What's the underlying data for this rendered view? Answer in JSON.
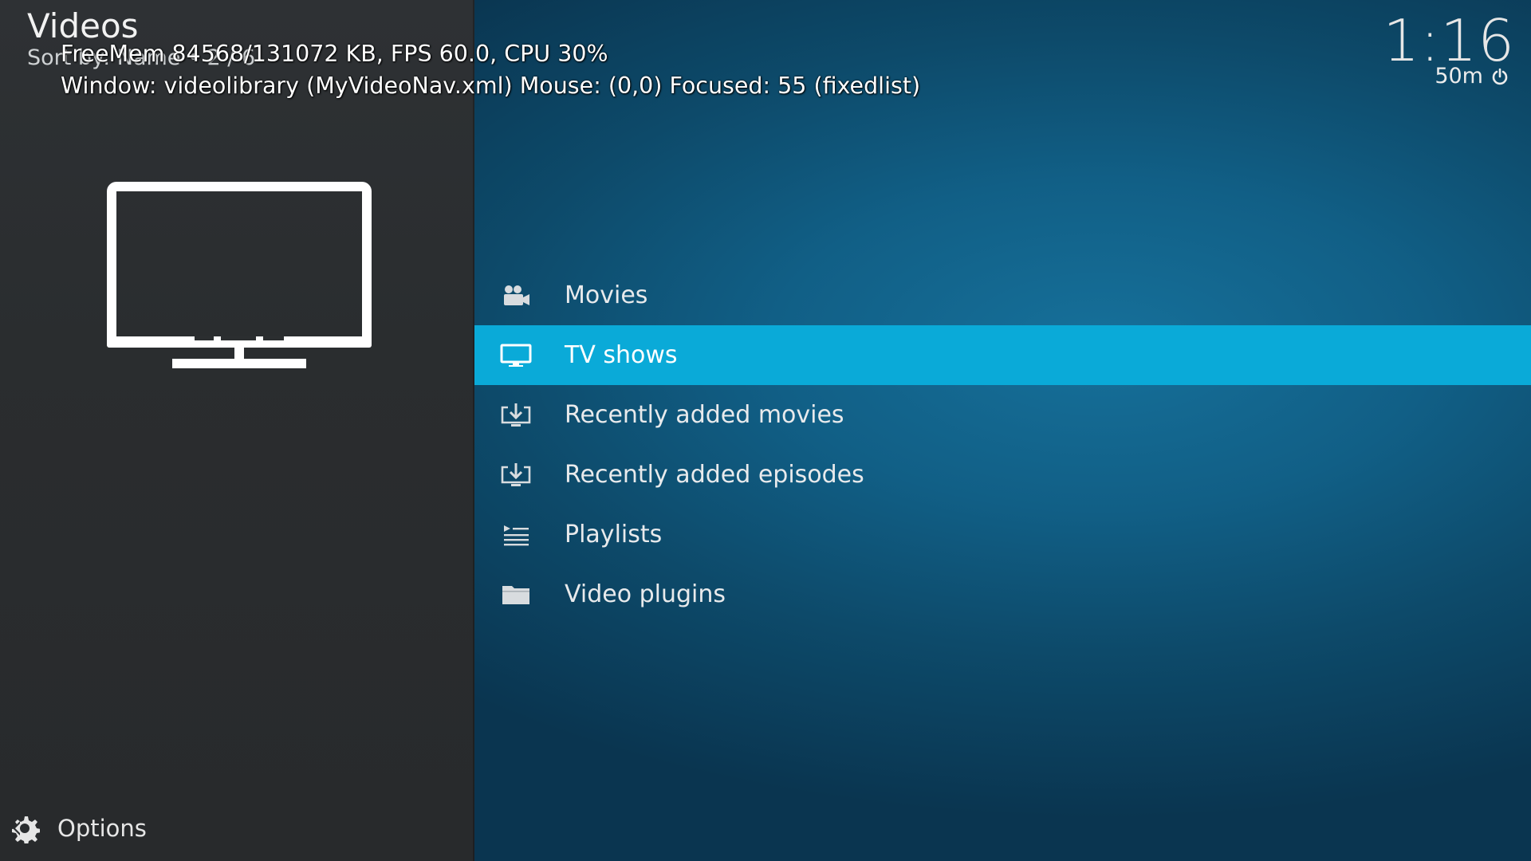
{
  "header": {
    "title": "Videos",
    "sort_label": "Sort by: Name • 2 / 6",
    "clock": "1:16",
    "sleep_timer": "50m"
  },
  "debug": {
    "line1": "FreeMem 84568/131072 KB, FPS 60.0, CPU 30%",
    "line2": "Window: videolibrary (MyVideoNav.xml)  Mouse: (0,0)  Focused: 55 (fixedlist)"
  },
  "menu": {
    "items": [
      {
        "label": "Movies",
        "icon": "movie-camera-icon",
        "focused": false
      },
      {
        "label": "TV shows",
        "icon": "tv-icon",
        "focused": true
      },
      {
        "label": "Recently added movies",
        "icon": "recently-added-icon",
        "focused": false
      },
      {
        "label": "Recently added episodes",
        "icon": "recently-added-icon",
        "focused": false
      },
      {
        "label": "Playlists",
        "icon": "playlist-icon",
        "focused": false
      },
      {
        "label": "Video plugins",
        "icon": "folder-icon",
        "focused": false
      }
    ]
  },
  "preview": {
    "icon": "tv-icon"
  },
  "footer": {
    "options_label": "Options"
  },
  "colors": {
    "focus_highlight": "#0aaad8",
    "left_panel": "#2b2e30",
    "background": "#115f86"
  }
}
